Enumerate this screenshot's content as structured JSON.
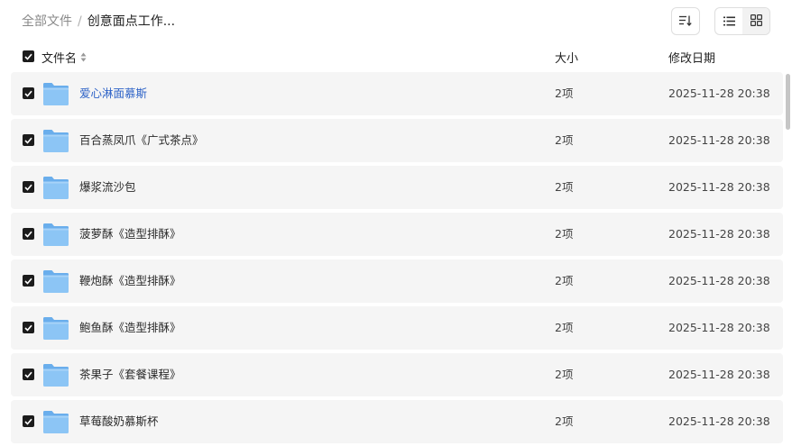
{
  "breadcrumb": {
    "root": "全部文件",
    "separator": "/",
    "current": "创意面点工作..."
  },
  "toolbar": {
    "sort_icon": "sort-descending-icon",
    "list_view_icon": "list-view-icon",
    "grid_view_icon": "grid-view-icon",
    "active_view": "list"
  },
  "table": {
    "columns": {
      "name": "文件名",
      "size": "大小",
      "date": "修改日期"
    },
    "all_selected": true,
    "rows": [
      {
        "name": "爱心淋面慕斯",
        "size": "2项",
        "date": "2025-11-28 20:38",
        "selected": true,
        "highlight": true
      },
      {
        "name": "百合蒸凤爪《广式茶点》",
        "size": "2项",
        "date": "2025-11-28 20:38",
        "selected": true
      },
      {
        "name": "爆浆流沙包",
        "size": "2项",
        "date": "2025-11-28 20:38",
        "selected": true
      },
      {
        "name": "菠萝酥《造型排酥》",
        "size": "2项",
        "date": "2025-11-28 20:38",
        "selected": true
      },
      {
        "name": "鞭炮酥《造型排酥》",
        "size": "2项",
        "date": "2025-11-28 20:38",
        "selected": true
      },
      {
        "name": "鲍鱼酥《造型排酥》",
        "size": "2项",
        "date": "2025-11-28 20:38",
        "selected": true
      },
      {
        "name": "茶果子《套餐课程》",
        "size": "2项",
        "date": "2025-11-28 20:38",
        "selected": true
      },
      {
        "name": "草莓酸奶慕斯杯",
        "size": "2项",
        "date": "2025-11-28 20:38",
        "selected": true
      }
    ]
  },
  "colors": {
    "link": "#2e63c7",
    "row_bg": "#f5f5f5",
    "checkbox": "#1c1c1c",
    "folder": "#7fbcf2"
  }
}
